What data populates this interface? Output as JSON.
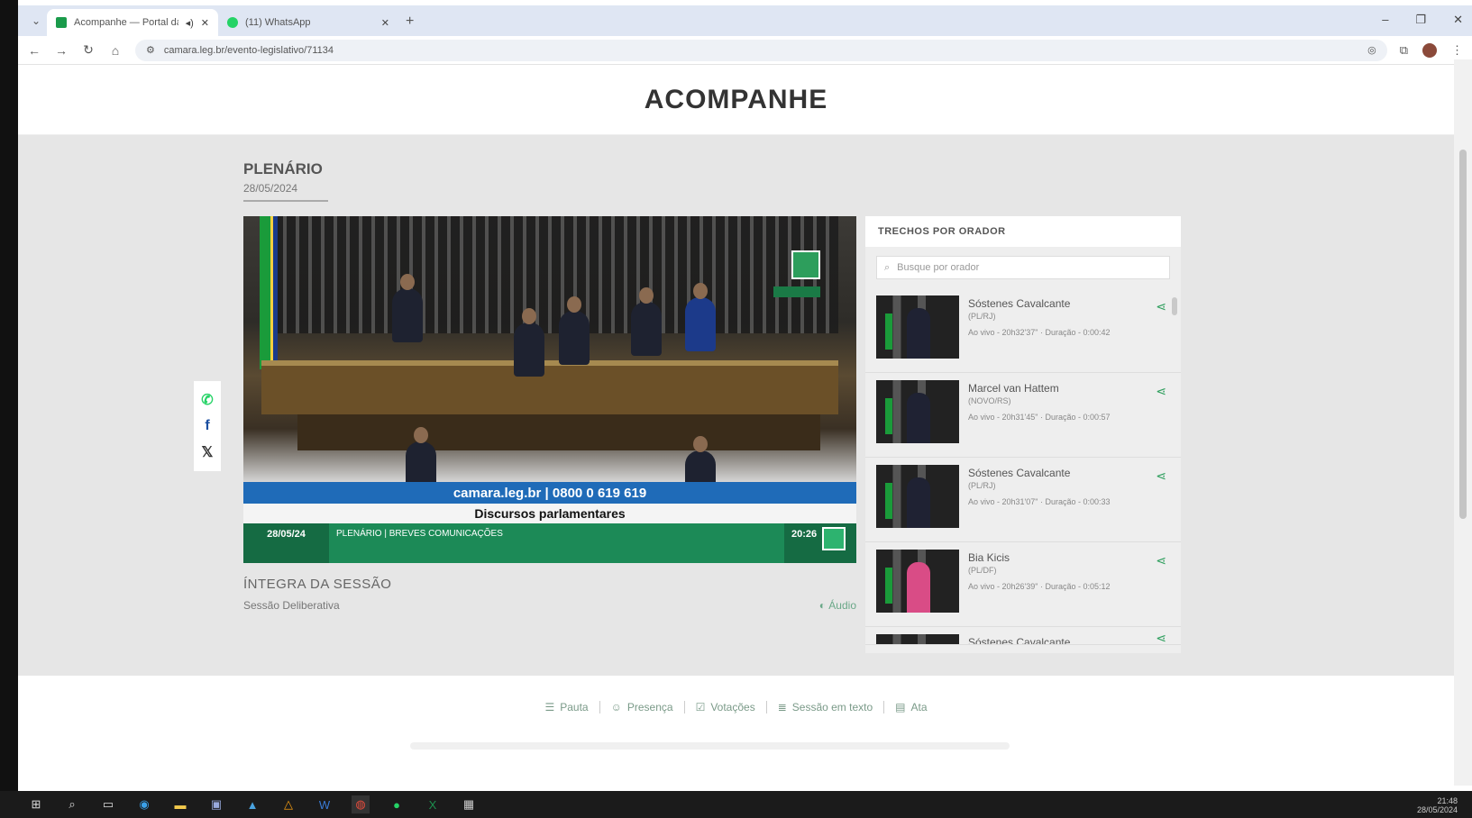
{
  "browser": {
    "tabs": [
      {
        "title": "Acompanhe — Portal da Câmara",
        "active": true
      },
      {
        "title": "(11) WhatsApp",
        "active": false
      }
    ],
    "url": "camara.leg.br/evento-legislativo/71134"
  },
  "page": {
    "title": "ACOMPANHE",
    "section": "PLENÁRIO",
    "date": "28/05/2024"
  },
  "video": {
    "site_line": "camara.leg.br | 0800 0 619 619",
    "program": "Discursos parlamentares",
    "bar_date": "28/05/24",
    "bar_label": "PLENÁRIO | BREVES COMUNICAÇÕES",
    "bar_time": "20:26"
  },
  "integra": {
    "title": "ÍNTEGRA DA SESSÃO",
    "subtitle": "Sessão Deliberativa",
    "audio_label": "Áudio"
  },
  "speakers_panel": {
    "title": "TRECHOS POR ORADOR",
    "search_placeholder": "Busque por orador",
    "speakers": [
      {
        "name": "Sóstenes Cavalcante",
        "party": "(PL/RJ)",
        "meta": "Ao vivo - 20h32'37\" · Duração - 0:00:42"
      },
      {
        "name": "Marcel van Hattem",
        "party": "(NOVO/RS)",
        "meta": "Ao vivo - 20h31'45\" · Duração - 0:00:57"
      },
      {
        "name": "Sóstenes Cavalcante",
        "party": "(PL/RJ)",
        "meta": "Ao vivo - 20h31'07\" · Duração - 0:00:33"
      },
      {
        "name": "Bia Kicis",
        "party": "(PL/DF)",
        "meta": "Ao vivo - 20h26'39\" · Duração - 0:05:12"
      },
      {
        "name": "Sóstenes Cavalcante",
        "party": "",
        "meta": ""
      }
    ]
  },
  "footer_nav": [
    {
      "icon": "list-icon",
      "label": "Pauta"
    },
    {
      "icon": "presence-icon",
      "label": "Presença"
    },
    {
      "icon": "votes-icon",
      "label": "Votações"
    },
    {
      "icon": "text-icon",
      "label": "Sessão em texto"
    },
    {
      "icon": "minutes-icon",
      "label": "Ata"
    }
  ],
  "taskbar": {
    "time": "21:48",
    "date": "28/05/2024"
  },
  "colors": {
    "accent_green": "#2d9e5c",
    "tv_blue": "#1f6bb8",
    "tv_green": "#1c8a57"
  }
}
